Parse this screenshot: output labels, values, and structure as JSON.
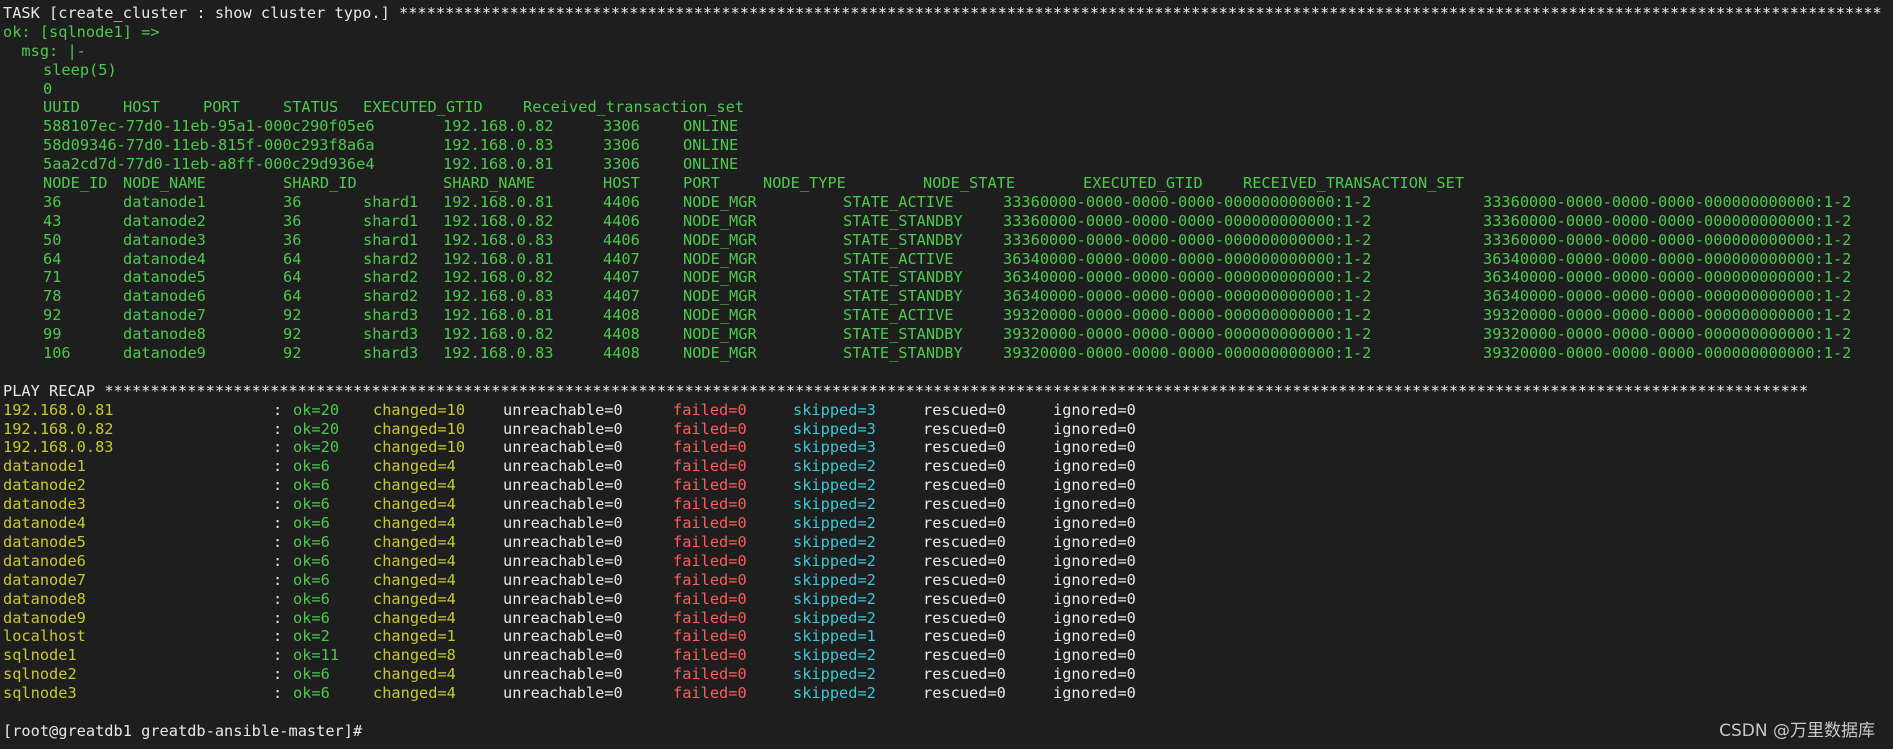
{
  "task_header": {
    "text": "TASK [create_cluster : show cluster typo.] ",
    "stars": "*****************************************************************************************************************************************************************"
  },
  "ok_line": "ok: [sqlnode1] =>",
  "msg_line": "  msg: |-",
  "msg_lines": [
    "sleep(5)",
    "0"
  ],
  "uuid_table": {
    "headers": [
      "UUID",
      "HOST",
      "PORT",
      "STATUS",
      "EXECUTED_GTID",
      "Received_transaction_set"
    ],
    "rows": [
      [
        "588107ec-77d0-11eb-95a1-000c290f05e6",
        "192.168.0.82",
        "3306",
        "ONLINE"
      ],
      [
        "58d09346-77d0-11eb-815f-000c293f8a6a",
        "192.168.0.83",
        "3306",
        "ONLINE"
      ],
      [
        "5aa2cd7d-77d0-11eb-a8ff-000c29d936e4",
        "192.168.0.81",
        "3306",
        "ONLINE"
      ]
    ]
  },
  "node_table": {
    "headers": [
      "NODE_ID",
      "NODE_NAME",
      "SHARD_ID",
      "SHARD_NAME",
      "HOST",
      "PORT",
      "NODE_TYPE",
      "NODE_STATE",
      "EXECUTED_GTID",
      "RECEIVED_TRANSACTION_SET"
    ],
    "rows": [
      [
        "36",
        "datanode1",
        "36",
        "shard1",
        "192.168.0.81",
        "4406",
        "NODE_MGR",
        "STATE_ACTIVE",
        "33360000-0000-0000-0000-000000000000:1-2",
        "33360000-0000-0000-0000-000000000000:1-2"
      ],
      [
        "43",
        "datanode2",
        "36",
        "shard1",
        "192.168.0.82",
        "4406",
        "NODE_MGR",
        "STATE_STANDBY",
        "33360000-0000-0000-0000-000000000000:1-2",
        "33360000-0000-0000-0000-000000000000:1-2"
      ],
      [
        "50",
        "datanode3",
        "36",
        "shard1",
        "192.168.0.83",
        "4406",
        "NODE_MGR",
        "STATE_STANDBY",
        "33360000-0000-0000-0000-000000000000:1-2",
        "33360000-0000-0000-0000-000000000000:1-2"
      ],
      [
        "64",
        "datanode4",
        "64",
        "shard2",
        "192.168.0.81",
        "4407",
        "NODE_MGR",
        "STATE_ACTIVE",
        "36340000-0000-0000-0000-000000000000:1-2",
        "36340000-0000-0000-0000-000000000000:1-2"
      ],
      [
        "71",
        "datanode5",
        "64",
        "shard2",
        "192.168.0.82",
        "4407",
        "NODE_MGR",
        "STATE_STANDBY",
        "36340000-0000-0000-0000-000000000000:1-2",
        "36340000-0000-0000-0000-000000000000:1-2"
      ],
      [
        "78",
        "datanode6",
        "64",
        "shard2",
        "192.168.0.83",
        "4407",
        "NODE_MGR",
        "STATE_STANDBY",
        "36340000-0000-0000-0000-000000000000:1-2",
        "36340000-0000-0000-0000-000000000000:1-2"
      ],
      [
        "92",
        "datanode7",
        "92",
        "shard3",
        "192.168.0.81",
        "4408",
        "NODE_MGR",
        "STATE_ACTIVE",
        "39320000-0000-0000-0000-000000000000:1-2",
        "39320000-0000-0000-0000-000000000000:1-2"
      ],
      [
        "99",
        "datanode8",
        "92",
        "shard3",
        "192.168.0.82",
        "4408",
        "NODE_MGR",
        "STATE_STANDBY",
        "39320000-0000-0000-0000-000000000000:1-2",
        "39320000-0000-0000-0000-000000000000:1-2"
      ],
      [
        "106",
        "datanode9",
        "92",
        "shard3",
        "192.168.0.83",
        "4408",
        "NODE_MGR",
        "STATE_STANDBY",
        "39320000-0000-0000-0000-000000000000:1-2",
        "39320000-0000-0000-0000-000000000000:1-2"
      ]
    ]
  },
  "recap_header": {
    "text": "PLAY RECAP ",
    "stars": "*****************************************************************************************************************************************************************************************"
  },
  "recap": [
    {
      "host": "192.168.0.81",
      "ok": "ok=20",
      "changed": "changed=10",
      "unreachable": "unreachable=0",
      "failed": "failed=0",
      "skipped": "skipped=3",
      "rescued": "rescued=0",
      "ignored": "ignored=0"
    },
    {
      "host": "192.168.0.82",
      "ok": "ok=20",
      "changed": "changed=10",
      "unreachable": "unreachable=0",
      "failed": "failed=0",
      "skipped": "skipped=3",
      "rescued": "rescued=0",
      "ignored": "ignored=0"
    },
    {
      "host": "192.168.0.83",
      "ok": "ok=20",
      "changed": "changed=10",
      "unreachable": "unreachable=0",
      "failed": "failed=0",
      "skipped": "skipped=3",
      "rescued": "rescued=0",
      "ignored": "ignored=0"
    },
    {
      "host": "datanode1",
      "ok": "ok=6",
      "changed": "changed=4",
      "unreachable": "unreachable=0",
      "failed": "failed=0",
      "skipped": "skipped=2",
      "rescued": "rescued=0",
      "ignored": "ignored=0"
    },
    {
      "host": "datanode2",
      "ok": "ok=6",
      "changed": "changed=4",
      "unreachable": "unreachable=0",
      "failed": "failed=0",
      "skipped": "skipped=2",
      "rescued": "rescued=0",
      "ignored": "ignored=0"
    },
    {
      "host": "datanode3",
      "ok": "ok=6",
      "changed": "changed=4",
      "unreachable": "unreachable=0",
      "failed": "failed=0",
      "skipped": "skipped=2",
      "rescued": "rescued=0",
      "ignored": "ignored=0"
    },
    {
      "host": "datanode4",
      "ok": "ok=6",
      "changed": "changed=4",
      "unreachable": "unreachable=0",
      "failed": "failed=0",
      "skipped": "skipped=2",
      "rescued": "rescued=0",
      "ignored": "ignored=0"
    },
    {
      "host": "datanode5",
      "ok": "ok=6",
      "changed": "changed=4",
      "unreachable": "unreachable=0",
      "failed": "failed=0",
      "skipped": "skipped=2",
      "rescued": "rescued=0",
      "ignored": "ignored=0"
    },
    {
      "host": "datanode6",
      "ok": "ok=6",
      "changed": "changed=4",
      "unreachable": "unreachable=0",
      "failed": "failed=0",
      "skipped": "skipped=2",
      "rescued": "rescued=0",
      "ignored": "ignored=0"
    },
    {
      "host": "datanode7",
      "ok": "ok=6",
      "changed": "changed=4",
      "unreachable": "unreachable=0",
      "failed": "failed=0",
      "skipped": "skipped=2",
      "rescued": "rescued=0",
      "ignored": "ignored=0"
    },
    {
      "host": "datanode8",
      "ok": "ok=6",
      "changed": "changed=4",
      "unreachable": "unreachable=0",
      "failed": "failed=0",
      "skipped": "skipped=2",
      "rescued": "rescued=0",
      "ignored": "ignored=0"
    },
    {
      "host": "datanode9",
      "ok": "ok=6",
      "changed": "changed=4",
      "unreachable": "unreachable=0",
      "failed": "failed=0",
      "skipped": "skipped=2",
      "rescued": "rescued=0",
      "ignored": "ignored=0"
    },
    {
      "host": "localhost",
      "ok": "ok=2",
      "changed": "changed=1",
      "unreachable": "unreachable=0",
      "failed": "failed=0",
      "skipped": "skipped=1",
      "rescued": "rescued=0",
      "ignored": "ignored=0"
    },
    {
      "host": "sqlnode1",
      "ok": "ok=11",
      "changed": "changed=8",
      "unreachable": "unreachable=0",
      "failed": "failed=0",
      "skipped": "skipped=2",
      "rescued": "rescued=0",
      "ignored": "ignored=0"
    },
    {
      "host": "sqlnode2",
      "ok": "ok=6",
      "changed": "changed=4",
      "unreachable": "unreachable=0",
      "failed": "failed=0",
      "skipped": "skipped=2",
      "rescued": "rescued=0",
      "ignored": "ignored=0"
    },
    {
      "host": "sqlnode3",
      "ok": "ok=6",
      "changed": "changed=4",
      "unreachable": "unreachable=0",
      "failed": "failed=0",
      "skipped": "skipped=2",
      "rescued": "rescued=0",
      "ignored": "ignored=0"
    }
  ],
  "prompt": "[root@greatdb1 greatdb-ansible-master]#",
  "watermark": "CSDN @万里数据库",
  "colors": {
    "background": "#1e1e1e",
    "text": "#e8e8e8",
    "ok_green": "#4ec94e",
    "changed_yellow": "#c8c832",
    "failed_red": "#ff5c5c",
    "skipped_cyan": "#3cc7d6"
  }
}
